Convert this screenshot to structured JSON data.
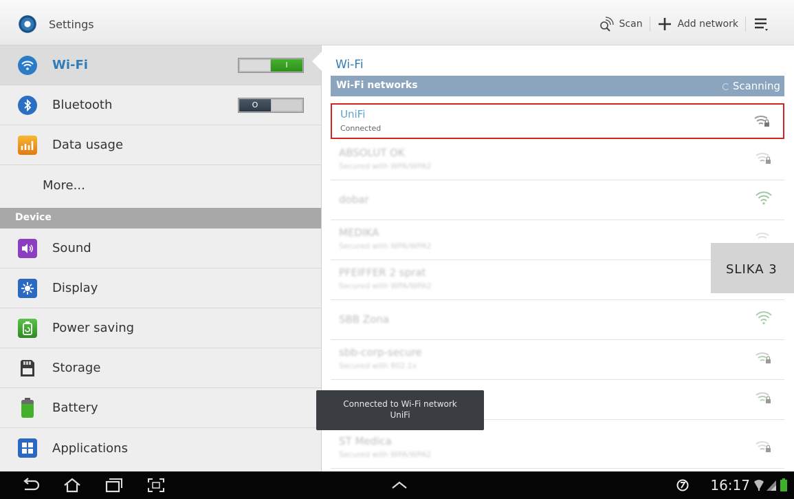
{
  "app": {
    "title": "Settings",
    "icon": "settings-gear-icon"
  },
  "actionbar": {
    "scan_label": "Scan",
    "add_network_label": "Add network"
  },
  "sidebar": {
    "items": [
      {
        "label": "Wi-Fi",
        "icon": "wifi-icon",
        "toggle": "I",
        "on": true
      },
      {
        "label": "Bluetooth",
        "icon": "bluetooth-icon",
        "toggle": "O",
        "on": false
      },
      {
        "label": "Data usage",
        "icon": "data-usage-icon"
      },
      {
        "label": "More..."
      }
    ],
    "section_device": "Device",
    "device_items": [
      {
        "label": "Sound",
        "icon": "sound-icon"
      },
      {
        "label": "Display",
        "icon": "display-icon"
      },
      {
        "label": "Power saving",
        "icon": "power-saving-icon"
      },
      {
        "label": "Storage",
        "icon": "storage-icon"
      },
      {
        "label": "Battery",
        "icon": "battery-icon"
      },
      {
        "label": "Applications",
        "icon": "applications-icon"
      }
    ]
  },
  "main": {
    "title": "Wi-Fi",
    "networks_header": "Wi-Fi networks",
    "scanning_label": "Scanning",
    "networks": [
      {
        "name": "UniFi",
        "status": "Connected"
      },
      {
        "name": "ABSOLUT OK",
        "status": "Secured with WPA/WPA2"
      },
      {
        "name": "dobar",
        "status": ""
      },
      {
        "name": "MEDIKA",
        "status": "Secured with WPA/WPA2"
      },
      {
        "name": "PFEIFFER 2 sprat",
        "status": "Secured with WPA/WPA2"
      },
      {
        "name": "SBB Zona",
        "status": ""
      },
      {
        "name": "sbb-corp-secure",
        "status": "Secured with 802.1x"
      },
      {
        "name": "",
        "status": ""
      },
      {
        "name": "ST Medica",
        "status": "Secured with WPA/WPA2"
      }
    ]
  },
  "toast": {
    "line1": "Connected to Wi-Fi network",
    "line2": "UniFi"
  },
  "overlay_label": "SLIKA 3",
  "statusbar": {
    "time": "16:17"
  },
  "colors": {
    "accent": "#2e7db8",
    "highlight_border": "#d32222",
    "toggle_on": "#3a9e26"
  }
}
